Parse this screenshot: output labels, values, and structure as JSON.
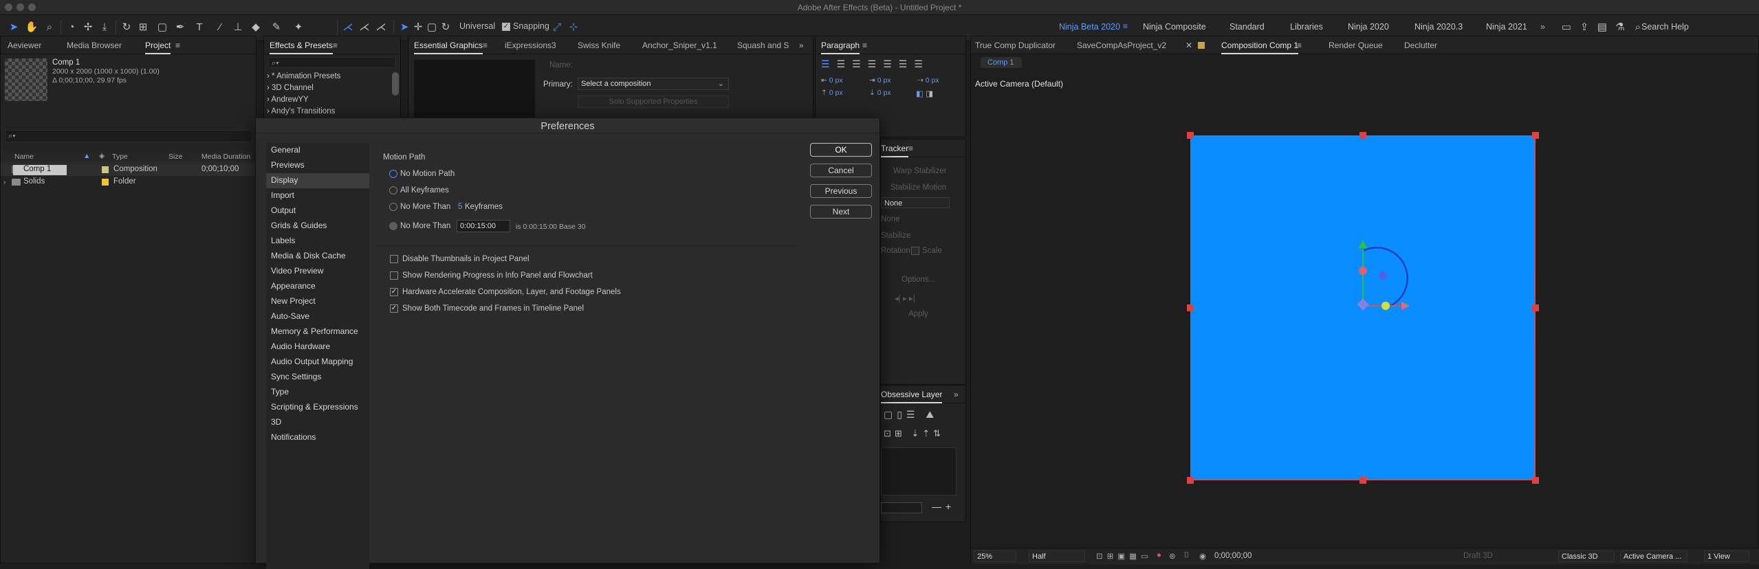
{
  "app_title": "Adobe After Effects (Beta) - Untitled Project *",
  "toolbar": {
    "universal_label": "Universal",
    "snapping_label": "Snapping",
    "snapping_checked": true,
    "workspaces": [
      "Ninja Beta 2020",
      "Ninja Composite",
      "Standard",
      "Libraries",
      "Ninja 2020",
      "Ninja 2020.3",
      "Ninja 2021"
    ],
    "active_workspace": "Ninja Beta 2020",
    "search_help": "Search Help"
  },
  "left_panel": {
    "tabs": [
      "Aeviewer",
      "Media Browser",
      "Project"
    ],
    "active_tab": "Project",
    "selected_item": {
      "name": "Comp 1",
      "size": "2000 x 2000  (1000 x 1000) (1.00)",
      "duration": "Δ 0;00;10;00, 29.97 fps"
    },
    "search_placeholder": "⌕▾",
    "columns": [
      "Name",
      "Type",
      "Size",
      "Media Duration"
    ],
    "rows": [
      {
        "name": "Comp 1",
        "type": "Composition",
        "size": "",
        "duration": "0;00;10;00",
        "label_color": "#c8c87a",
        "selected": true
      },
      {
        "name": "Solids",
        "type": "Folder",
        "size": "",
        "duration": "",
        "label_color": "#f0c23c",
        "selected": false
      }
    ]
  },
  "effects_panel": {
    "title": "Effects & Presets",
    "search_placeholder": "⌕▾",
    "items": [
      "* Animation Presets",
      "3D Channel",
      "AndrewYY",
      "Andy's Transitions"
    ]
  },
  "essential_graphics": {
    "tabs": [
      "Essential Graphics",
      "iExpressions3",
      "Swiss Knife",
      "Anchor_Sniper_v1.1",
      "Squash and S"
    ],
    "active_tab": "Essential Graphics",
    "name_label": "Name:",
    "primary_label": "Primary:",
    "primary_value": "Select a composition",
    "solo_button": "Solo Supported Properties"
  },
  "paragraph_panel": {
    "title": "Paragraph",
    "indent_values": [
      "0 px",
      "0 px",
      "0 px",
      "0 px",
      "0 px"
    ]
  },
  "tracker_panel": {
    "title": "Tracker",
    "warp_stabilizer": "Warp Stabilizer",
    "stabilize_motion": "Stabilize Motion",
    "source_value": "None",
    "current_track": "None",
    "stabilize": "Stabilize",
    "rotation": "Rotation",
    "scale": "Scale",
    "options": "Options...",
    "apply": "Apply"
  },
  "obsessive_panel": {
    "title": "Obsessive Layer"
  },
  "preferences": {
    "title": "Preferences",
    "categories": [
      "General",
      "Previews",
      "Display",
      "Import",
      "Output",
      "Grids & Guides",
      "Labels",
      "Media & Disk Cache",
      "Video Preview",
      "Appearance",
      "New Project",
      "Auto-Save",
      "Memory & Performance",
      "Audio Hardware",
      "Audio Output Mapping",
      "Sync Settings",
      "Type",
      "Scripting & Expressions",
      "3D",
      "Notifications"
    ],
    "active_category": "Display",
    "motion_path_heading": "Motion Path",
    "radio_no_motion_path": "No Motion Path",
    "radio_all_keyframes": "All Keyframes",
    "radio_no_more_than": "No More Than",
    "keyframes_value": "5",
    "keyframes_unit": "Keyframes",
    "radio_no_more_than_time": "No More Than",
    "time_value": "0:00:15:00",
    "time_info": "is 0:00:15:00  Base 30",
    "checkboxes": [
      {
        "label": "Disable Thumbnails in Project Panel",
        "checked": false
      },
      {
        "label": "Show Rendering Progress in Info Panel and Flowchart",
        "checked": false
      },
      {
        "label": "Hardware Accelerate Composition, Layer, and Footage Panels",
        "checked": true
      },
      {
        "label": "Show Both Timecode and Frames in Timeline Panel",
        "checked": true
      }
    ],
    "buttons": {
      "ok": "OK",
      "cancel": "Cancel",
      "previous": "Previous",
      "next": "Next"
    }
  },
  "composition_panel": {
    "tabs": [
      "True Comp Duplicator",
      "SaveCompAsProject_v2",
      "Composition Comp 1",
      "Render Queue",
      "Declutter"
    ],
    "active_tab": "Composition Comp 1",
    "breadcrumb": "Comp 1",
    "camera_label": "Active Camera (Default)",
    "solid_color": "#0a8eff",
    "footer": {
      "zoom": "25%",
      "resolution": "Half",
      "timecode": "0;00;00;00",
      "draft3d": "Draft 3D",
      "renderer": "Classic 3D",
      "camera": "Active Camera ...",
      "views": "1 View"
    }
  }
}
